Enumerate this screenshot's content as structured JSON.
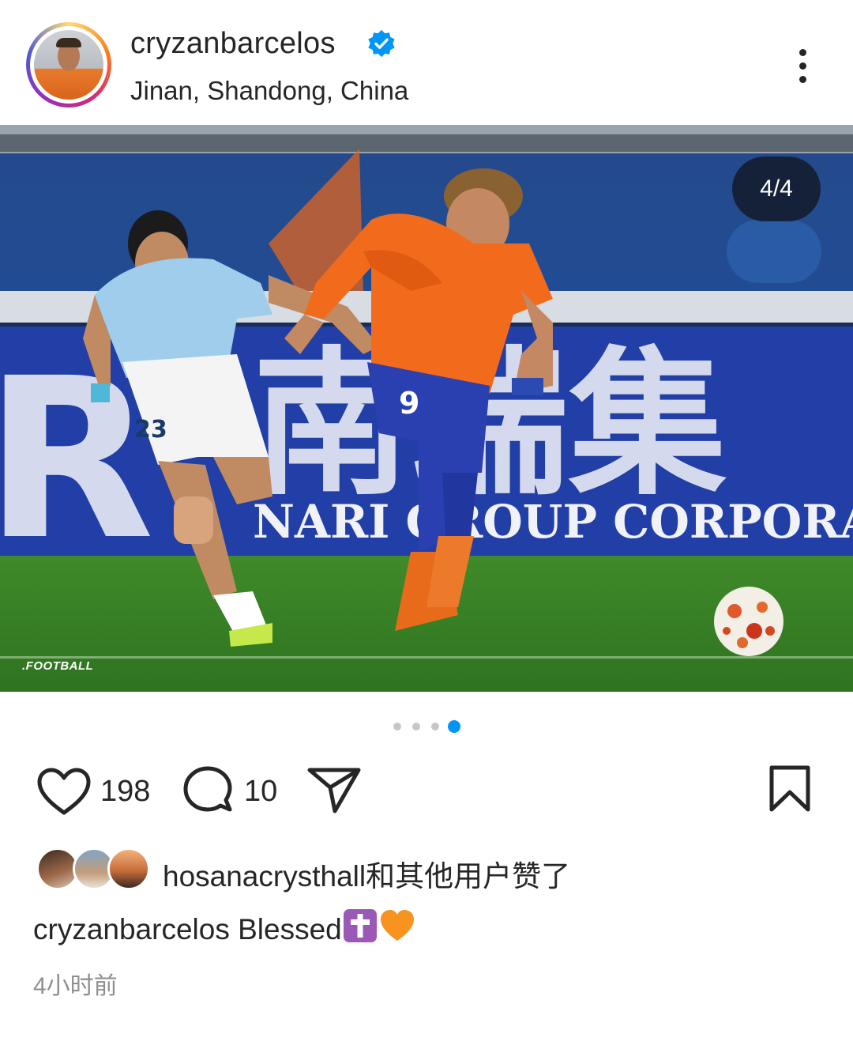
{
  "header": {
    "username": "cryzanbarcelos",
    "location": "Jinan, Shandong, China",
    "verified_color": "#0095f6"
  },
  "photo": {
    "counter": "4/4",
    "watermark": ".FOOTBALL",
    "board_chinese": "南瑞集",
    "board_english": "NARI GROUP CORPORA",
    "jersey_number_orange": "9",
    "jersey_number_blue": "23"
  },
  "carousel": {
    "total": 4,
    "active": 4
  },
  "actions": {
    "likes_count": "198",
    "comments_count": "10"
  },
  "liked_by": {
    "user": "hosanacrysthall",
    "suffix": "和其他用户赞了"
  },
  "caption": {
    "username": "cryzanbarcelos",
    "text": "Blessed"
  },
  "timestamp": "4小时前",
  "colors": {
    "accent": "#0095f6",
    "text": "#262626",
    "muted": "#8e8e8e",
    "orange_kit": "#f26a1b",
    "blue_kit": "#8ec6e8"
  }
}
